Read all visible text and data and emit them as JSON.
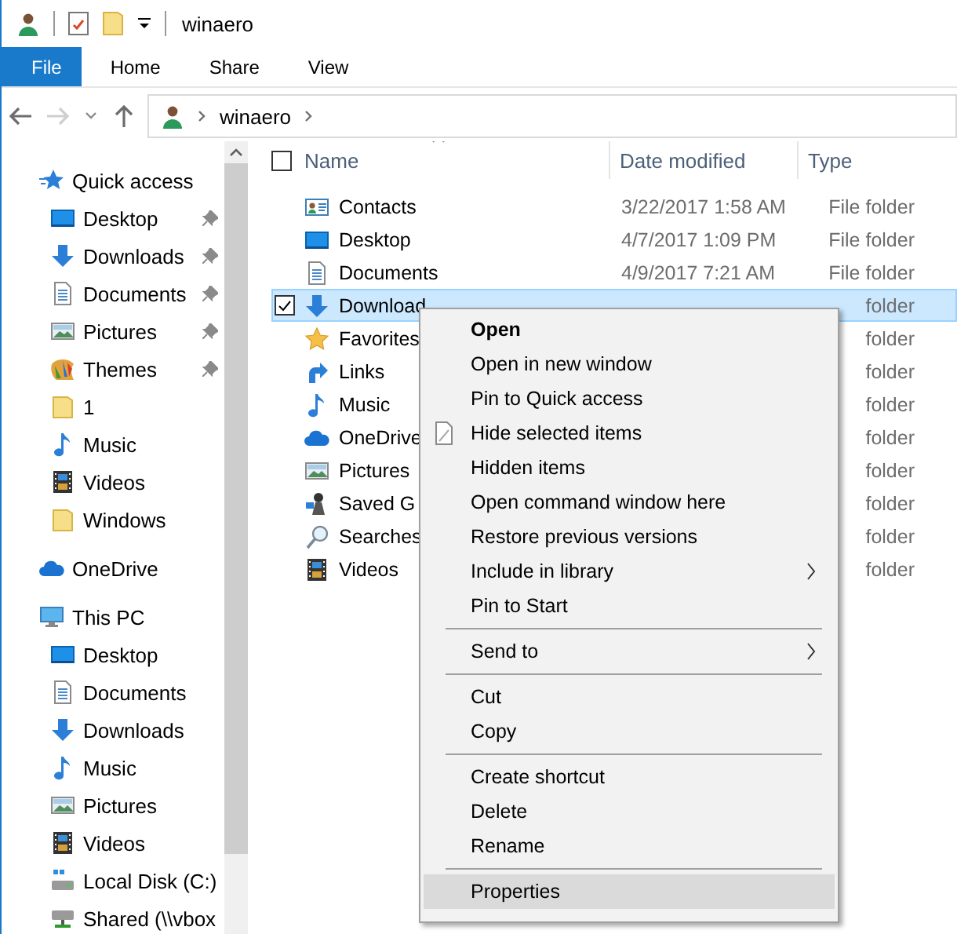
{
  "window": {
    "title": "winaero"
  },
  "ribbon": {
    "tabs": [
      {
        "label": "File",
        "kind": "file"
      },
      {
        "label": "Home",
        "kind": "tab"
      },
      {
        "label": "Share",
        "kind": "tab"
      },
      {
        "label": "View",
        "kind": "tab"
      }
    ]
  },
  "address": {
    "path": [
      "winaero"
    ]
  },
  "nav": {
    "sections": [
      {
        "label": "Quick access",
        "kind": "star",
        "children": [
          {
            "label": "Desktop",
            "kind": "desktop",
            "pinned": true
          },
          {
            "label": "Downloads",
            "kind": "downloads",
            "pinned": true
          },
          {
            "label": "Documents",
            "kind": "documents",
            "pinned": true
          },
          {
            "label": "Pictures",
            "kind": "pictures",
            "pinned": true
          },
          {
            "label": "Themes",
            "kind": "themes",
            "pinned": true
          },
          {
            "label": "1",
            "kind": "folder",
            "pinned": false
          },
          {
            "label": "Music",
            "kind": "music",
            "pinned": false
          },
          {
            "label": "Videos",
            "kind": "videos",
            "pinned": false
          },
          {
            "label": "Windows",
            "kind": "folder",
            "pinned": false
          }
        ]
      },
      {
        "label": "OneDrive",
        "kind": "onedrive"
      },
      {
        "label": "This PC",
        "kind": "pc",
        "children": [
          {
            "label": "Desktop",
            "kind": "desktop"
          },
          {
            "label": "Documents",
            "kind": "documents"
          },
          {
            "label": "Downloads",
            "kind": "downloads"
          },
          {
            "label": "Music",
            "kind": "music"
          },
          {
            "label": "Pictures",
            "kind": "pictures"
          },
          {
            "label": "Videos",
            "kind": "videos"
          },
          {
            "label": "Local Disk (C:)",
            "kind": "drive"
          },
          {
            "label": "Shared (\\\\vbox",
            "kind": "netdrive"
          }
        ]
      }
    ]
  },
  "list": {
    "select_all": {
      "checked": false
    },
    "columns": [
      {
        "label": "Name",
        "sorted": true
      },
      {
        "label": "Date modified",
        "sorted": false
      },
      {
        "label": "Type",
        "sorted": false
      }
    ],
    "rows": [
      {
        "name": "Contacts",
        "kind": "contacts",
        "date": "3/22/2017 1:58 AM",
        "type": "File folder",
        "selected": false,
        "checked": false
      },
      {
        "name": "Desktop",
        "kind": "desktop",
        "date": "4/7/2017 1:09 PM",
        "type": "File folder",
        "selected": false,
        "checked": false
      },
      {
        "name": "Documents",
        "kind": "documents",
        "date": "4/9/2017 7:21 AM",
        "type": "File folder",
        "selected": false,
        "checked": false
      },
      {
        "name": "Download",
        "kind": "downloads",
        "type": "folder",
        "selected": true,
        "checked": true
      },
      {
        "name": "Favorites",
        "kind": "favorites",
        "type": "folder",
        "selected": false,
        "checked": false
      },
      {
        "name": "Links",
        "kind": "links",
        "type": "folder",
        "selected": false,
        "checked": false
      },
      {
        "name": "Music",
        "kind": "music",
        "type": "folder",
        "selected": false,
        "checked": false
      },
      {
        "name": "OneDrive",
        "kind": "onedrive",
        "type": "folder",
        "selected": false,
        "checked": false
      },
      {
        "name": "Pictures",
        "kind": "pictures",
        "type": "folder",
        "selected": false,
        "checked": false
      },
      {
        "name": "Saved G",
        "kind": "games",
        "type": "folder",
        "selected": false,
        "checked": false
      },
      {
        "name": "Searches",
        "kind": "searches",
        "type": "folder",
        "selected": false,
        "checked": false
      },
      {
        "name": "Videos",
        "kind": "videos",
        "type": "folder",
        "selected": false,
        "checked": false
      }
    ]
  },
  "menu": {
    "groups": [
      [
        {
          "label": "Open",
          "kind": "command",
          "default": true,
          "submenu": false,
          "selected": false
        },
        {
          "label": "Open in new window",
          "kind": "command",
          "default": false,
          "submenu": false,
          "selected": false
        },
        {
          "label": "Pin to Quick access",
          "kind": "command",
          "default": false,
          "submenu": false,
          "selected": false
        },
        {
          "label": "Hide selected items",
          "kind": "toggle",
          "default": false,
          "submenu": false,
          "selected": false
        },
        {
          "label": "Hidden items",
          "kind": "command",
          "default": false,
          "submenu": false,
          "selected": false
        },
        {
          "label": "Open command window here",
          "kind": "command",
          "default": false,
          "submenu": false,
          "selected": false
        },
        {
          "label": "Restore previous versions",
          "kind": "command",
          "default": false,
          "submenu": false,
          "selected": false
        },
        {
          "label": "Include in library",
          "kind": "command",
          "default": false,
          "submenu": true,
          "selected": false
        },
        {
          "label": "Pin to Start",
          "kind": "command",
          "default": false,
          "submenu": false,
          "selected": false
        }
      ],
      [
        {
          "label": "Send to",
          "kind": "command",
          "default": false,
          "submenu": true,
          "selected": false
        }
      ],
      [
        {
          "label": "Cut",
          "kind": "command",
          "default": false,
          "submenu": false,
          "selected": false
        },
        {
          "label": "Copy",
          "kind": "command",
          "default": false,
          "submenu": false,
          "selected": false
        }
      ],
      [
        {
          "label": "Create shortcut",
          "kind": "command",
          "default": false,
          "submenu": false,
          "selected": false
        },
        {
          "label": "Delete",
          "kind": "command",
          "default": false,
          "submenu": false,
          "selected": false
        },
        {
          "label": "Rename",
          "kind": "command",
          "default": false,
          "submenu": false,
          "selected": false
        }
      ],
      [
        {
          "label": "Properties",
          "kind": "command",
          "default": false,
          "submenu": false,
          "selected": true
        }
      ]
    ]
  }
}
